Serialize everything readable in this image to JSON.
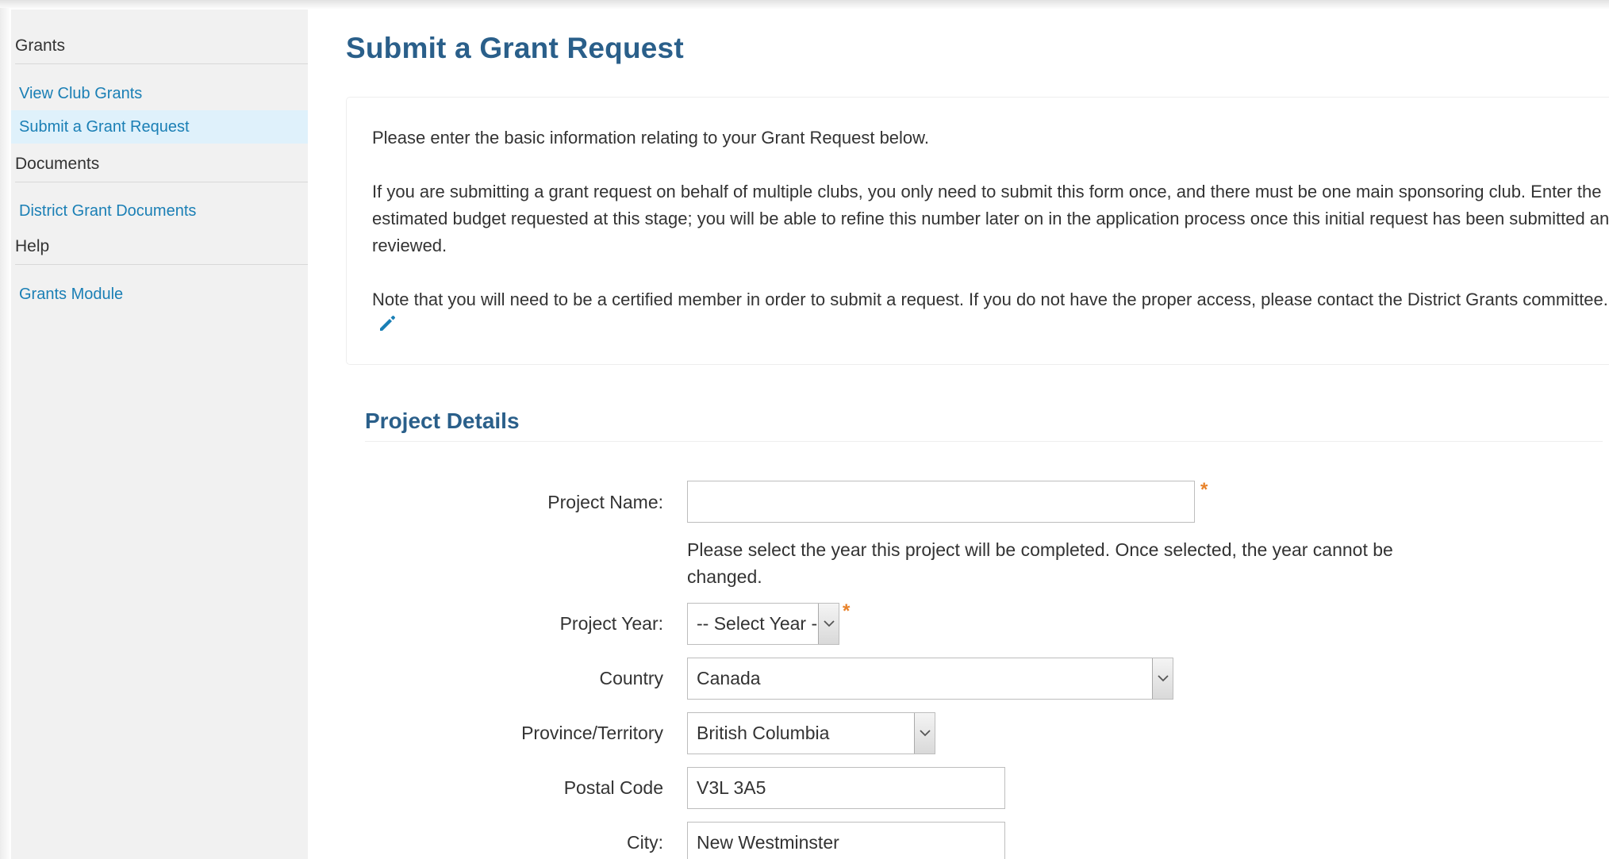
{
  "sidebar": {
    "sections": [
      {
        "heading": "Grants",
        "items": [
          {
            "label": "View Club Grants",
            "active": false
          },
          {
            "label": "Submit a Grant Request",
            "active": true
          }
        ]
      },
      {
        "heading": "Documents",
        "items": [
          {
            "label": "District Grant Documents",
            "active": false
          }
        ]
      },
      {
        "heading": "Help",
        "items": [
          {
            "label": "Grants Module",
            "active": false
          }
        ]
      }
    ]
  },
  "main": {
    "title": "Submit a Grant Request",
    "info": {
      "p1": "Please enter the basic information relating to your Grant Request below.",
      "p2": "If you are submitting a grant request on behalf of multiple clubs, you only need to submit this form once, and there must be one main sponsoring club. Enter the estimated budget requested at this stage; you will be able to refine this number later on in the application process once this initial request has been submitted and reviewed.",
      "p3": "Note that you will need to be a certified member in order to submit a request. If you do not have the proper access, please contact the District Grants committee.",
      "edit_icon": "pencil-icon"
    },
    "section_title": "Project Details",
    "form": {
      "project_name": {
        "label": "Project Name:",
        "value": "",
        "required": true
      },
      "year_help": "Please select the year this project will be completed. Once selected, the year cannot be changed.",
      "project_year": {
        "label": "Project Year:",
        "value": "-- Select Year --",
        "required": true
      },
      "country": {
        "label": "Country",
        "value": "Canada"
      },
      "province": {
        "label": "Province/Territory",
        "value": "British Columbia"
      },
      "postal_code": {
        "label": "Postal Code",
        "value": "V3L 3A5"
      },
      "city": {
        "label": "City:",
        "value": "New Westminster"
      },
      "required_marker": "*"
    }
  },
  "colors": {
    "accent": "#2a5f8a",
    "link": "#1a7fb5",
    "required": "#e8822a",
    "sidebar_bg": "#f1f1f1",
    "active_bg": "#dff1fb"
  }
}
